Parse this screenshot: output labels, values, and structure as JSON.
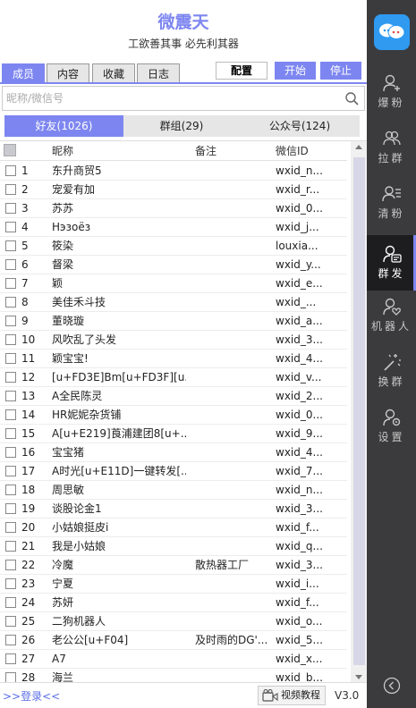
{
  "app": {
    "title": "微震天",
    "subtitle": "工欲善其事 必先利其器"
  },
  "top_tabs": [
    "成员",
    "内容",
    "收藏",
    "日志"
  ],
  "buttons": {
    "config": "配置",
    "start": "开始",
    "stop": "停止"
  },
  "search": {
    "placeholder": "昵称/微信号"
  },
  "segments": [
    "好友(1026)",
    "群组(29)",
    "公众号(124)"
  ],
  "table": {
    "headers": {
      "nick": "昵称",
      "note": "备注",
      "id": "微信ID"
    },
    "rows": [
      {
        "n": "1",
        "nick": "东升商贸5",
        "note": "",
        "id": "wxid_n..."
      },
      {
        "n": "2",
        "nick": "宠爱有加",
        "note": "",
        "id": "wxid_r..."
      },
      {
        "n": "3",
        "nick": "苏苏",
        "note": "",
        "id": "wxid_0..."
      },
      {
        "n": "4",
        "nick": "Нэзоёз",
        "note": "",
        "id": "wxid_j..."
      },
      {
        "n": "5",
        "nick": "筱染",
        "note": "",
        "id": "louxia..."
      },
      {
        "n": "6",
        "nick": "督梁",
        "note": "",
        "id": "wxid_y..."
      },
      {
        "n": "7",
        "nick": "颖",
        "note": "",
        "id": "wxid_e..."
      },
      {
        "n": "8",
        "nick": "美佳禾斗技",
        "note": "",
        "id": "wxid_..."
      },
      {
        "n": "9",
        "nick": "董晓璇",
        "note": "",
        "id": "wxid_a..."
      },
      {
        "n": "10",
        "nick": "风吹乱了头发",
        "note": "",
        "id": "wxid_3..."
      },
      {
        "n": "11",
        "nick": "颖宝宝!",
        "note": "",
        "id": "wxid_4..."
      },
      {
        "n": "12",
        "nick": "[u+FD3E]Bm[u+FD3F][u...",
        "note": "",
        "id": "wxid_v..."
      },
      {
        "n": "13",
        "nick": "A全民陈灵",
        "note": "",
        "id": "wxid_2..."
      },
      {
        "n": "14",
        "nick": "HR妮妮杂货铺",
        "note": "",
        "id": "wxid_0..."
      },
      {
        "n": "15",
        "nick": "A[u+E219]莨浦建团8[u+...",
        "note": "",
        "id": "wxid_9..."
      },
      {
        "n": "16",
        "nick": "宝宝猪",
        "note": "",
        "id": "wxid_4..."
      },
      {
        "n": "17",
        "nick": "A时光[u+E11D]一键转发[...",
        "note": "",
        "id": "wxid_7..."
      },
      {
        "n": "18",
        "nick": "周思敏",
        "note": "",
        "id": "wxid_n..."
      },
      {
        "n": "19",
        "nick": "谈股论金1",
        "note": "",
        "id": "wxid_3..."
      },
      {
        "n": "20",
        "nick": "小姑娘挺皮i",
        "note": "",
        "id": "wxid_f..."
      },
      {
        "n": "21",
        "nick": "我是小姑娘",
        "note": "",
        "id": "wxid_q..."
      },
      {
        "n": "22",
        "nick": "冷魔",
        "note": "散热器工厂",
        "id": "wxid_3..."
      },
      {
        "n": "23",
        "nick": "宁夏",
        "note": "",
        "id": "wxid_i..."
      },
      {
        "n": "24",
        "nick": "苏妍",
        "note": "",
        "id": "wxid_f..."
      },
      {
        "n": "25",
        "nick": "二狗机器人",
        "note": "",
        "id": "wxid_o..."
      },
      {
        "n": "26",
        "nick": "老公公[u+F04]",
        "note": "及时雨的DG'...",
        "id": "wxid_5..."
      },
      {
        "n": "27",
        "nick": "A7",
        "note": "",
        "id": "wxid_x..."
      },
      {
        "n": "28",
        "nick": "海兰",
        "note": "",
        "id": "wxid_b..."
      }
    ]
  },
  "footer": {
    "login": ">>登录<<",
    "video": "视频教程",
    "version": "V3.0"
  },
  "sidebar": {
    "items": [
      {
        "label": "爆粉",
        "icon": "user-add-icon"
      },
      {
        "label": "拉群",
        "icon": "group-icon"
      },
      {
        "label": "清粉",
        "icon": "user-list-icon"
      },
      {
        "label": "群发",
        "icon": "user-message-icon"
      },
      {
        "label": "机器人",
        "icon": "user-heart-icon"
      },
      {
        "label": "换群",
        "icon": "magic-wand-icon"
      },
      {
        "label": "设置",
        "icon": "user-settings-icon"
      }
    ]
  },
  "colors": {
    "accent": "#7d86f0",
    "rail": "#3b3b3e",
    "logo": "#2f9af0"
  }
}
